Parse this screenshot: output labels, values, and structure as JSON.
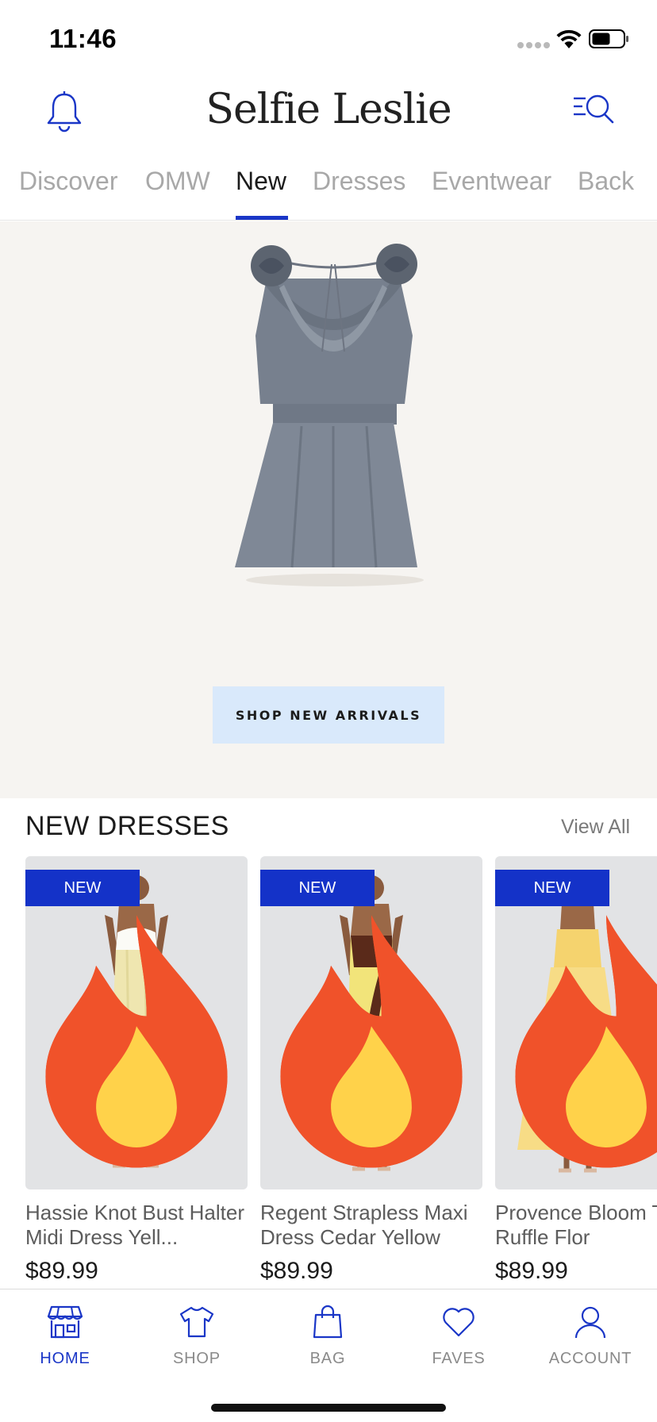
{
  "status_bar": {
    "time": "11:46"
  },
  "header": {
    "brand": "Selfie Leslie"
  },
  "tabs": [
    {
      "label": "Discover"
    },
    {
      "label": "OMW"
    },
    {
      "label": "New"
    },
    {
      "label": "Dresses"
    },
    {
      "label": "Eventwear"
    },
    {
      "label": "Back"
    }
  ],
  "active_tab": "New",
  "hero": {
    "cta_label": "SHOP NEW ARRIVALS"
  },
  "section": {
    "title": "NEW DRESSES",
    "view_all": "View All"
  },
  "products": [
    {
      "badge": "NEW",
      "name": "Hassie Knot Bust Halter Midi Dress Yell...",
      "price": "$89.99"
    },
    {
      "badge": "NEW",
      "name": "Regent Strapless Maxi Dress Cedar Yellow",
      "price": "$89.99"
    },
    {
      "badge": "NEW",
      "name": "Provence Bloom Tiered Ruffle Flor",
      "price": "$89.99"
    }
  ],
  "bottom_nav": [
    {
      "label": "HOME"
    },
    {
      "label": "SHOP"
    },
    {
      "label": "BAG"
    },
    {
      "label": "FAVES"
    },
    {
      "label": "ACCOUNT"
    }
  ],
  "colors": {
    "accent": "#1a36c7",
    "badge": "#1432c8",
    "cta_background": "#d9e9fb",
    "hero_background": "#f6f4f1"
  }
}
